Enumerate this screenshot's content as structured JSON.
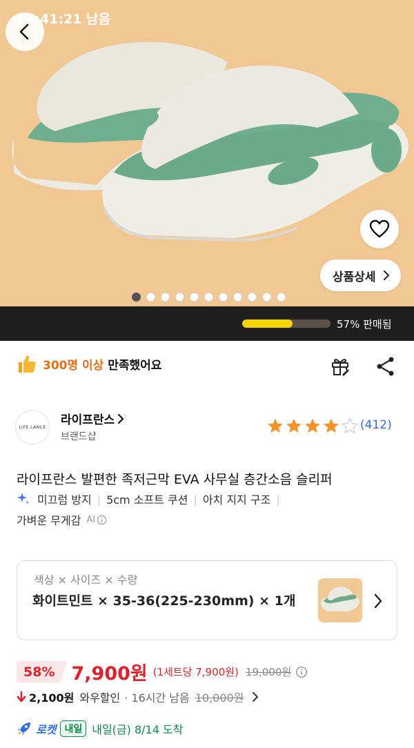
{
  "hero": {
    "back_icon": "chevron-left-icon",
    "wishlist_icon": "heart-icon",
    "detail_button_label": "상품상세",
    "image_count": 11,
    "active_image_index": 0,
    "background_color": "#f0c994"
  },
  "timer": {
    "remaining_text": "16:41:21 남음",
    "sold_percent": 57,
    "sold_text": "57% 판매됨",
    "bar_color": "#f6d400"
  },
  "satisfaction": {
    "icon": "thumbs-up-icon",
    "highlight": "300명 이상",
    "text": "만족했어요",
    "gift_icon": "gift-icon",
    "share_icon": "share-icon"
  },
  "brand": {
    "logo_text": "LIFE LANCE",
    "name": "라이프란스",
    "sub": "브랜드샵",
    "rating": 4,
    "rating_max": 5,
    "review_count": "(412)"
  },
  "product": {
    "title": "라이프란스 발편한 족저근막 EVA 사무실 층간소음 슬리퍼",
    "features": [
      "미끄럼 방지",
      "5cm 소프트 쿠션",
      "아치 지지 구조"
    ],
    "feature_last": "가벼운 무게감",
    "ai_label": "AI"
  },
  "option": {
    "label": "색상 × 사이즈 × 수량",
    "value": "화이트민트 × 35-36(225-230mm) × 1개"
  },
  "price": {
    "discount": "58%",
    "sale": "7,900원",
    "unit": "(1세트당 7,900원)",
    "original": "19,000원",
    "accent_color": "#e0202a"
  },
  "wow": {
    "amount": "2,100원",
    "label": "와우할인",
    "time": "· 16시간 남음",
    "original": "10,000원"
  },
  "delivery": {
    "rocket": "로켓",
    "badge": "내일",
    "text": "내일(금) 8/14 도착",
    "color": "#0e8a4c"
  }
}
